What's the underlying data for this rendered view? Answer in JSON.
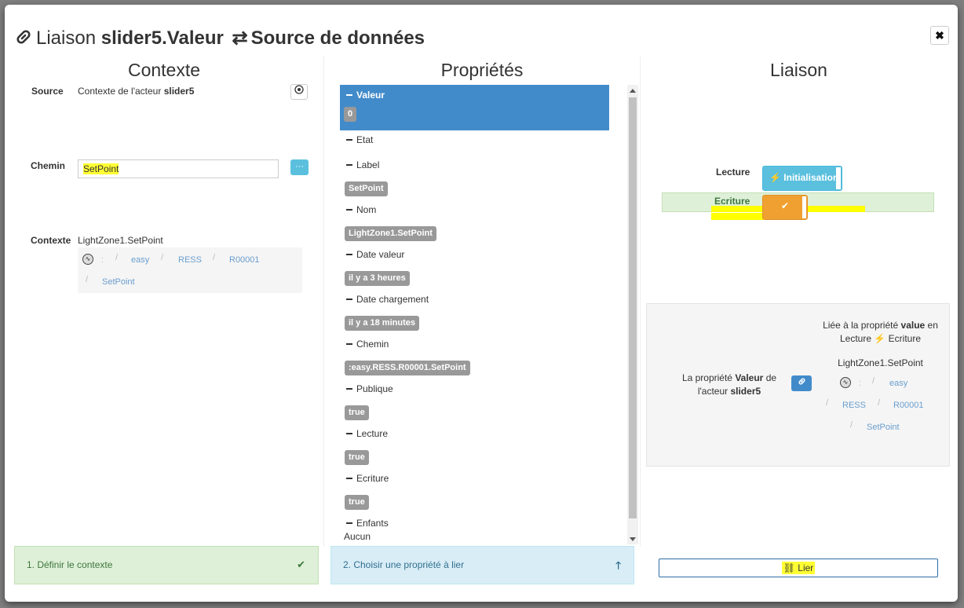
{
  "modal": {
    "title_prefix": "Liaison ",
    "title_actor": "slider5",
    "title_prop": ".Valeur",
    "title_arrows": "⇄",
    "title_target": "Source de données",
    "close": "✖"
  },
  "contexte": {
    "title": "Contexte",
    "source_label": "Source",
    "source_text": "Contexte de l'acteur",
    "source_actor": "slider5",
    "chemin_label": "Chemin",
    "chemin_value": "SetPoint",
    "chemin_btn": "···",
    "contexte_label": "Contexte",
    "contexte_value": "LightZone1.SetPoint",
    "breadcrumb": {
      "colon": ":",
      "items": [
        "easy",
        "RESS",
        "R00001",
        "SetPoint"
      ]
    }
  },
  "proprietes": {
    "title": "Propriétés",
    "items": [
      {
        "name": "Valeur",
        "value": "0"
      },
      {
        "name": "Etat"
      },
      {
        "name": "Label",
        "value": "SetPoint"
      },
      {
        "name": "Nom",
        "value": "LightZone1.SetPoint"
      },
      {
        "name": "Date valeur",
        "value": "il y a 3 heures"
      },
      {
        "name": "Date chargement",
        "value": "il y a 18 minutes"
      },
      {
        "name": "Chemin",
        "value": ":easy.RESS.R00001.SetPoint"
      },
      {
        "name": "Publique",
        "value": "true"
      },
      {
        "name": "Lecture",
        "value": "true"
      },
      {
        "name": "Ecriture",
        "value": "true"
      },
      {
        "name": "Enfants",
        "text": "Aucun"
      }
    ]
  },
  "liaison": {
    "title": "Liaison",
    "lecture_label": "Lecture",
    "lecture_btn": "Initialisation",
    "ecriture_label": "Ecriture",
    "info": {
      "left_prefix": "La propriété",
      "left_prop": "Valeur",
      "left_de": "de",
      "left_line2_prefix": "l'acteur",
      "left_actor": "slider5",
      "right_line1_prefix": "Liée à la propriété",
      "right_prop": "value",
      "right_line1_suffix": "en",
      "right_line2_a": "Lecture",
      "right_line2_b": "Ecriture",
      "path_value": "LightZone1.SetPoint",
      "breadcrumb_colon": ":",
      "breadcrumb_items": [
        "easy",
        "RESS",
        "R00001",
        "SetPoint"
      ]
    }
  },
  "footer": {
    "step1": "1. Définir le contexte",
    "step2": "2. Choisir une propriété à lier",
    "lier": "Lier"
  },
  "colors": {
    "primary": "#428bca",
    "info": "#5bc0de",
    "success_bg": "#dff0d8",
    "warning": "#f0a030",
    "highlight": "#ffff33"
  }
}
